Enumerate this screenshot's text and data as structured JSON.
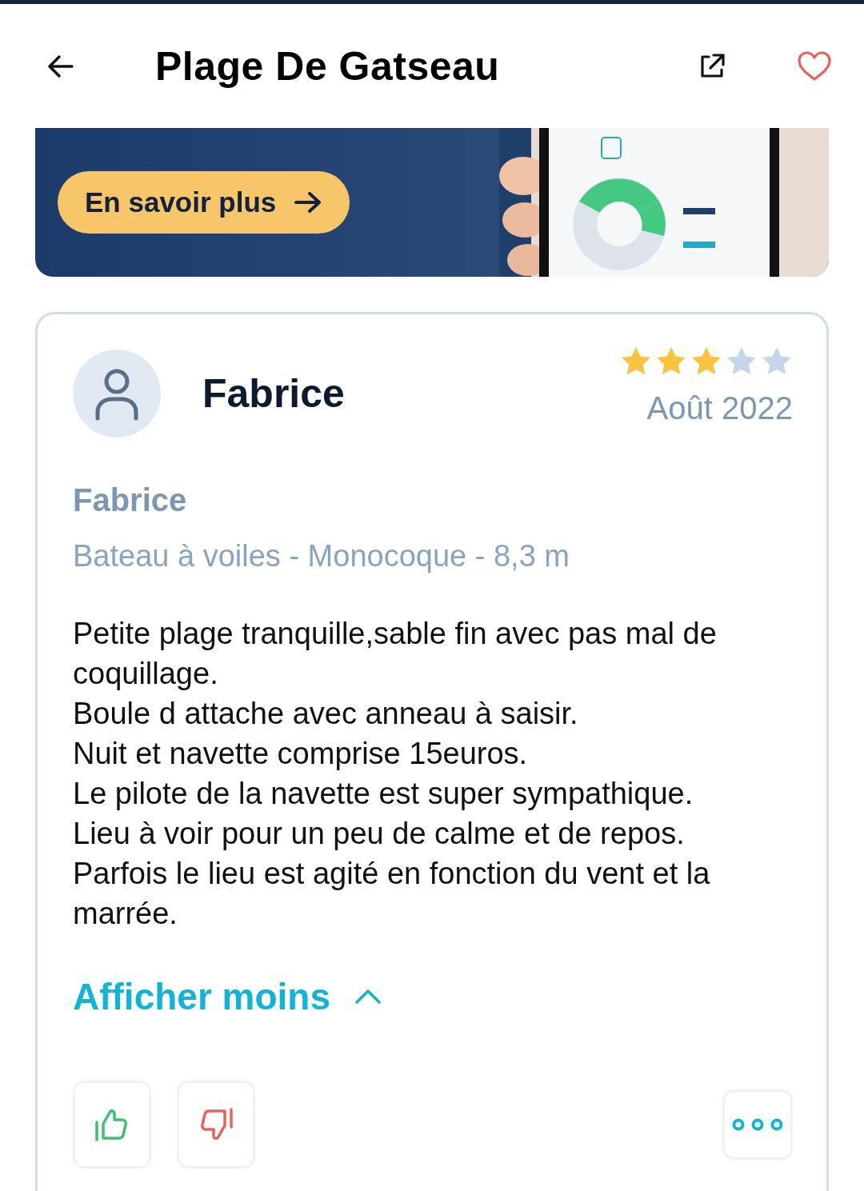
{
  "header": {
    "title": "Plage De Gatseau"
  },
  "banner": {
    "button": "En savoir plus"
  },
  "review": {
    "author": "Fabrice",
    "stars": 3,
    "date": "Août 2022",
    "boat_owner": "Fabrice",
    "boat": "Bateau à voiles - Monocoque - 8,3 m",
    "lines": [
      "Petite plage tranquille,sable fin avec pas mal de coquillage.",
      "Boule d attache avec anneau à saisir.",
      "Nuit et navette comprise 15euros.",
      "Le pilote de la navette est super sympathique.",
      "Lieu à voir pour un peu de calme et de repos.",
      "Parfois le lieu est agité en fonction du vent et la marrée."
    ],
    "toggle": {
      "label": "Afficher moins",
      "expanded": true
    }
  }
}
